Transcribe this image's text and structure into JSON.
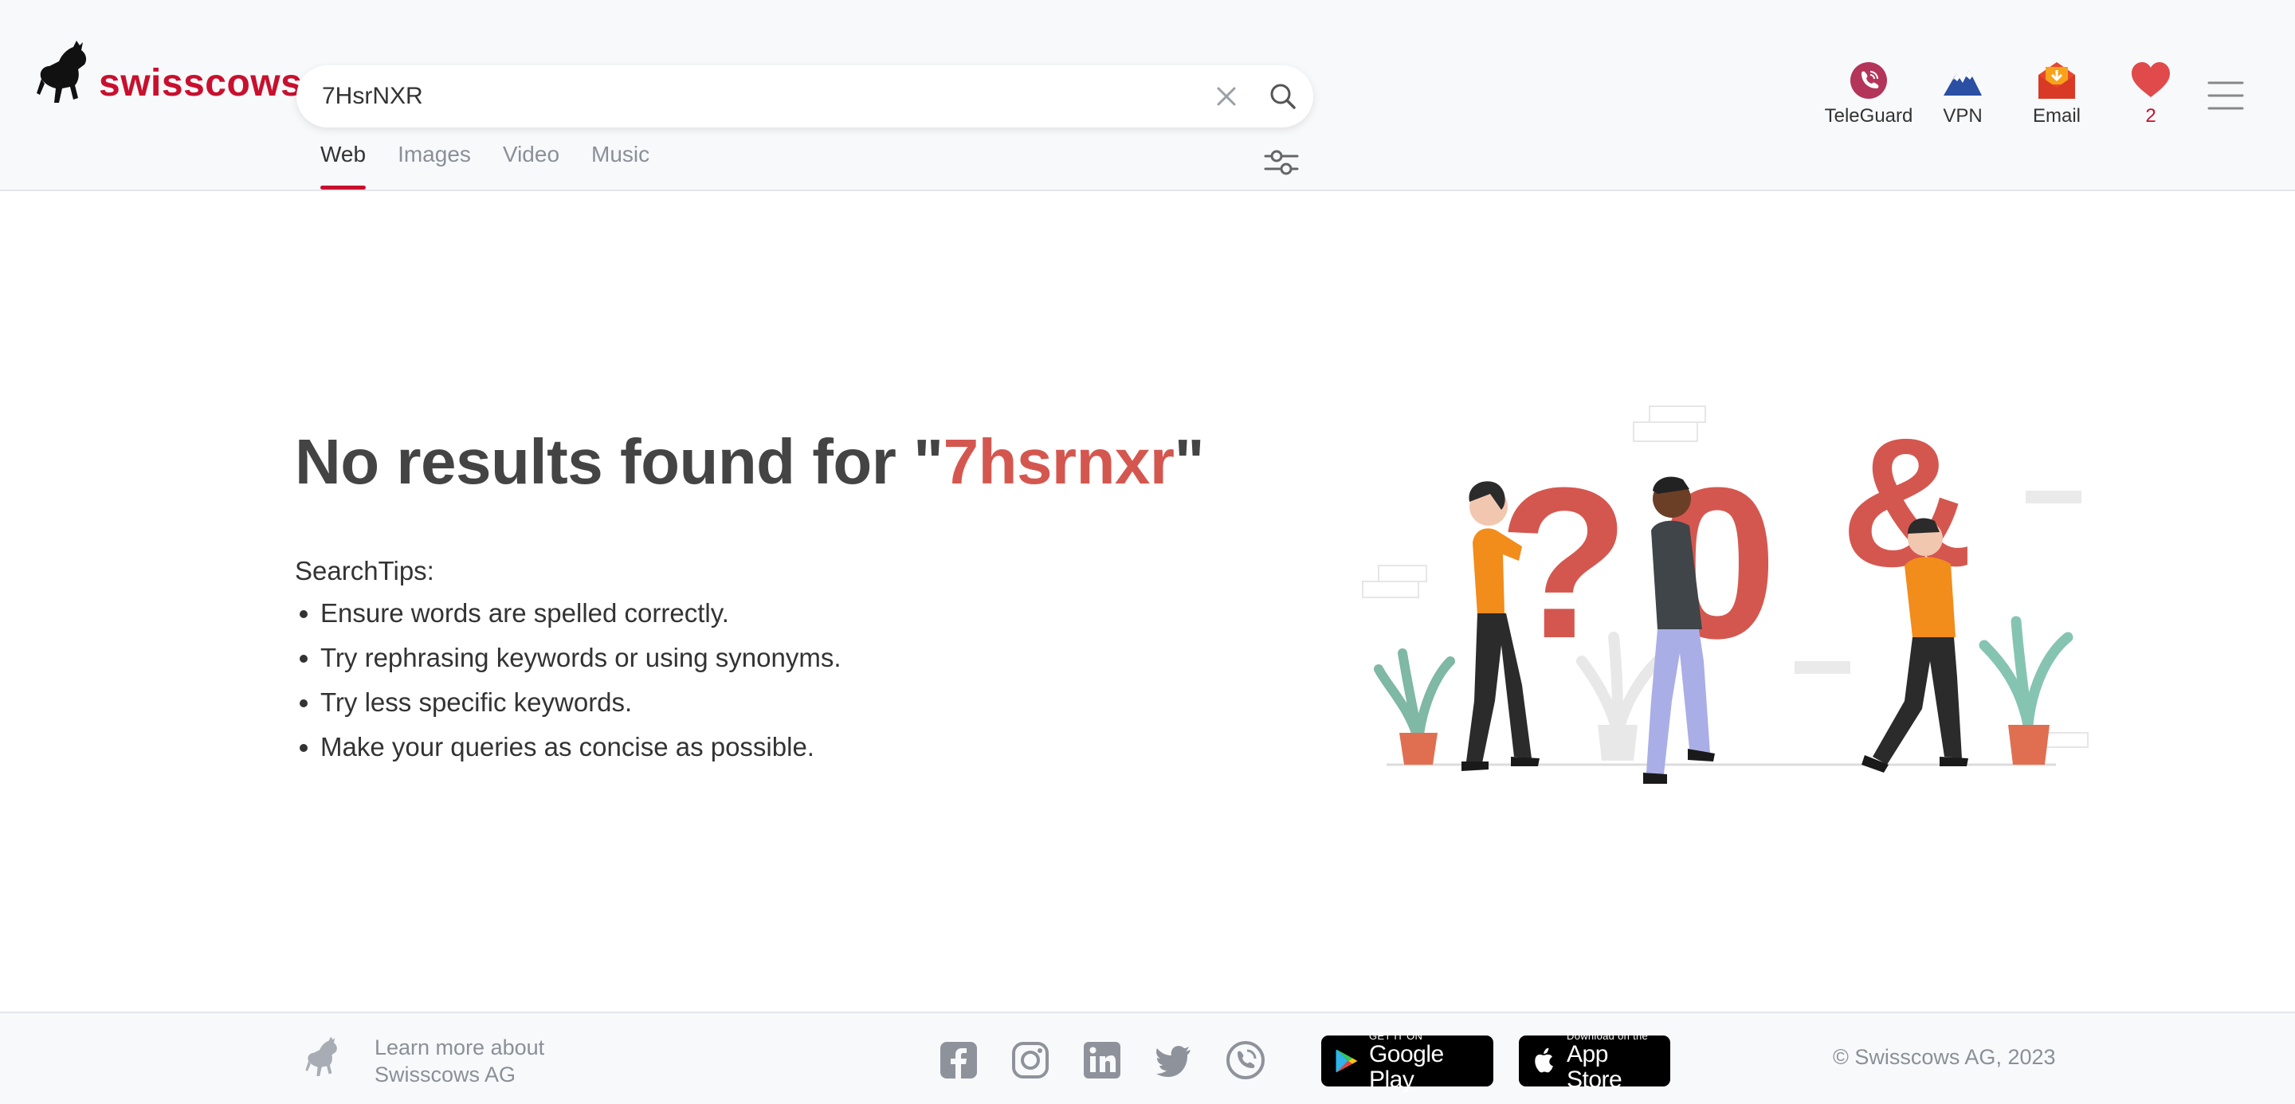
{
  "brand": {
    "name": "swisscows",
    "accent": "#c8102e",
    "title_accent": "#d4574f"
  },
  "search": {
    "value": "7HsrNXR",
    "placeholder": ""
  },
  "tabs": [
    {
      "label": "Web",
      "active": true
    },
    {
      "label": "Images",
      "active": false
    },
    {
      "label": "Video",
      "active": false
    },
    {
      "label": "Music",
      "active": false
    }
  ],
  "apps": [
    {
      "label": "TeleGuard",
      "icon": "teleguard-icon"
    },
    {
      "label": "VPN",
      "icon": "vpn-icon"
    },
    {
      "label": "Email",
      "icon": "email-icon"
    },
    {
      "label": "2",
      "icon": "heart-icon"
    }
  ],
  "main": {
    "title_prefix": "No results found for \"",
    "query": "7hsrnxr",
    "title_suffix": "\"",
    "tips_heading": "SearchTips:",
    "tips": [
      "Ensure words are spelled correctly.",
      "Try rephrasing keywords or using synonyms.",
      "Try less specific keywords.",
      "Make your queries as concise as possible."
    ],
    "illustration_glyphs": [
      "?",
      "0",
      "&"
    ]
  },
  "footer": {
    "learn_line1": "Learn more about",
    "learn_line2": "Swisscows AG",
    "social": [
      "facebook-icon",
      "instagram-icon",
      "linkedin-icon",
      "twitter-icon",
      "teleguard-icon"
    ],
    "google_small": "GET IT ON",
    "google_big": "Google Play",
    "apple_small": "Download on the",
    "apple_big": "App Store",
    "copyright": "© Swisscows AG, 2023"
  }
}
